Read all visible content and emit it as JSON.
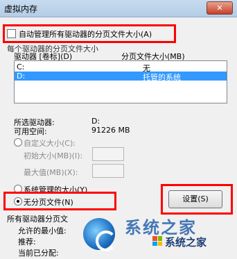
{
  "window": {
    "title": "虚拟内存",
    "close_glyph": "✕"
  },
  "auto_manage": {
    "label": "自动管理所有驱动器的分页文件大小(A)",
    "checked": false
  },
  "group": {
    "label": "每个驱动器的分页文件大小"
  },
  "columns": {
    "drive": "驱动器 [卷标](D)",
    "size": "分页文件大小(MB)"
  },
  "drives": [
    {
      "drive": "C:",
      "size": "无",
      "selected": false
    },
    {
      "drive": "D:",
      "size": "托管的系统",
      "selected": true
    }
  ],
  "info": {
    "selected_drive_label": "所选驱动器:",
    "selected_drive_value": "D:",
    "free_space_label": "可用空间:",
    "free_space_value": "91226 MB"
  },
  "custom_size": {
    "label": "自定义大小(C):",
    "initial_label": "初始大小(MB)(I):",
    "max_label": "最大值(MB)(X):"
  },
  "system_managed": {
    "label": "系统管理的大小(Y)"
  },
  "no_paging": {
    "label": "无分页文件(N)",
    "checked": true
  },
  "set_button": {
    "label": "设置(S)"
  },
  "total": {
    "group_label": "所有驱动器分页文",
    "min_label": "允许的最小值:",
    "recommended_label": "推荐:",
    "current_label": "当前已分配:"
  },
  "watermark": {
    "big": "系统之家",
    "text": "系统之家"
  },
  "colors": {
    "highlight": "#ff0000",
    "selection": "#3399ff"
  }
}
